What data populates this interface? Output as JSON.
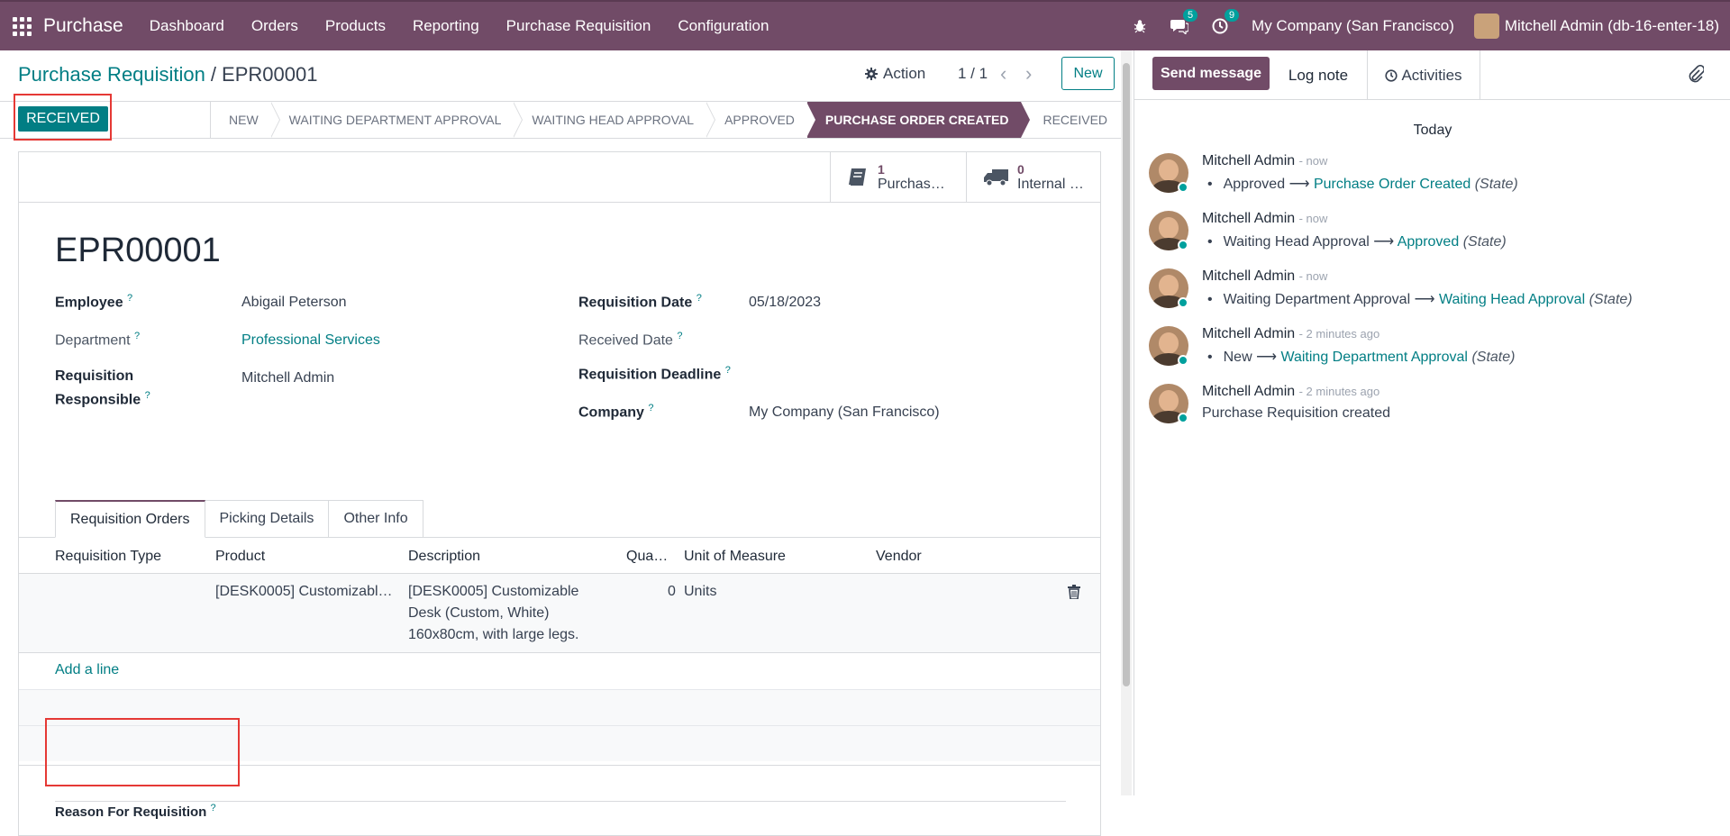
{
  "topbar": {
    "app_name": "Purchase",
    "menu": [
      "Dashboard",
      "Orders",
      "Products",
      "Reporting",
      "Purchase Requisition",
      "Configuration"
    ],
    "messages_count": "5",
    "activities_count": "9",
    "company": "My Company (San Francisco)",
    "user": "Mitchell Admin (db-16-enter-18)"
  },
  "breadcrumb": {
    "parent": "Purchase Requisition",
    "separator": "/",
    "current": "EPR00001"
  },
  "control": {
    "action_label": "Action",
    "pager": "1 / 1",
    "new_label": "New"
  },
  "status": {
    "button_label": "RECEIVED",
    "stages": [
      "NEW",
      "WAITING DEPARTMENT APPROVAL",
      "WAITING HEAD APPROVAL",
      "APPROVED",
      "PURCHASE ORDER CREATED",
      "RECEIVED"
    ],
    "active_stage": "PURCHASE ORDER CREATED"
  },
  "smart_buttons": [
    {
      "count": "1",
      "label": "Purchas…"
    },
    {
      "count": "0",
      "label": "Internal …"
    }
  ],
  "record": {
    "name": "EPR00001",
    "employee_label": "Employee",
    "employee": "Abigail Peterson",
    "department_label": "Department",
    "department": "Professional Services",
    "responsible_label_1": "Requisition",
    "responsible_label_2": "Responsible",
    "responsible": "Mitchell Admin",
    "req_date_label": "Requisition Date",
    "req_date": "05/18/2023",
    "received_date_label": "Received Date",
    "deadline_label": "Requisition Deadline",
    "company_label": "Company",
    "company": "My Company (San Francisco)",
    "help": "?"
  },
  "tabs": [
    "Requisition Orders",
    "Picking Details",
    "Other Info"
  ],
  "table": {
    "columns": [
      "Requisition Type",
      "Product",
      "Description",
      "Qua…",
      "Unit of Measure",
      "Vendor"
    ],
    "rows": [
      {
        "type": "",
        "product": "[DESK0005] Customizabl…",
        "description_1": "[DESK0005] Customizable",
        "description_2": "Desk (Custom, White)",
        "description_3": "160x80cm, with large legs.",
        "qty": "0",
        "uom": "Units",
        "vendor": ""
      }
    ],
    "add_line": "Add a line"
  },
  "reason_label": "Reason For Requisition",
  "chatter": {
    "send_message": "Send message",
    "log_note": "Log note",
    "activities": "Activities",
    "today": "Today",
    "messages": [
      {
        "author": "Mitchell Admin",
        "time": "- now",
        "old": "Approved",
        "new": "Purchase Order Created",
        "field": "(State)"
      },
      {
        "author": "Mitchell Admin",
        "time": "- now",
        "old": "Waiting Head Approval",
        "new": "Approved",
        "field": "(State)"
      },
      {
        "author": "Mitchell Admin",
        "time": "- now",
        "old": "Waiting Department Approval",
        "new": "Waiting Head Approval",
        "field": "(State)"
      },
      {
        "author": "Mitchell Admin",
        "time": "- 2 minutes ago",
        "old": "New",
        "new": "Waiting Department Approval",
        "field": "(State)"
      },
      {
        "author": "Mitchell Admin",
        "time": "- 2 minutes ago",
        "text": "Purchase Requisition created"
      }
    ]
  },
  "colors": {
    "brand": "#714B67",
    "accent": "#017E84",
    "highlight": "#e53935"
  }
}
